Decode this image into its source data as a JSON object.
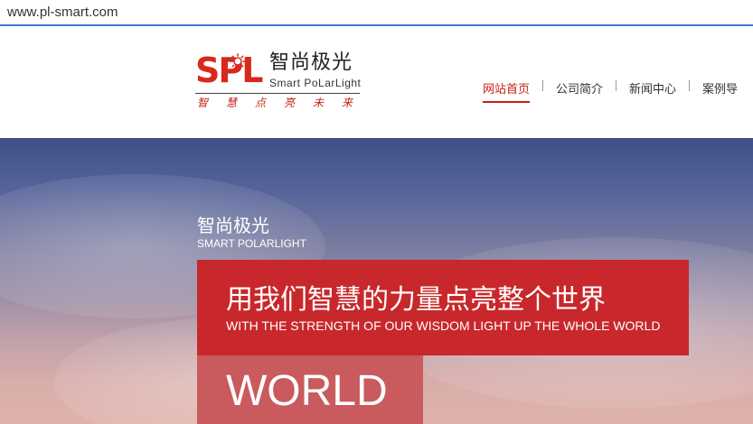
{
  "browser": {
    "url": "www.pl-smart.com"
  },
  "logo": {
    "mark": "SPL",
    "name_cn": "智尚极光",
    "name_en": "Smart PoLarLight",
    "slogan": "智慧点亮未来"
  },
  "nav": {
    "items": [
      {
        "label": "网站首页",
        "active": true
      },
      {
        "label": "公司简介"
      },
      {
        "label": "新闻中心"
      },
      {
        "label": "案例导"
      }
    ]
  },
  "hero": {
    "subtitle_cn": "智尚极光",
    "subtitle_en": "SMART POLARLIGHT",
    "title_cn": "用我们智慧的力量点亮整个世界",
    "title_en": "WITH THE STRENGTH OF OUR WISDOM LIGHT UP THE WHOLE WORLD",
    "word": "WORLD",
    "colors": {
      "banner": "#c8282b",
      "word_box": "#c95a5e",
      "accent": "#c71f16"
    }
  }
}
